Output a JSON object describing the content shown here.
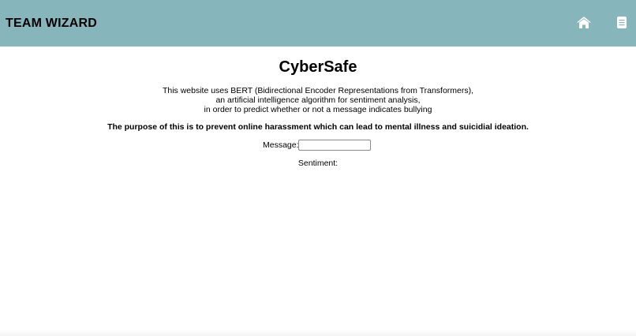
{
  "header": {
    "brand": "TEAM WIZARD",
    "icons": {
      "home": "home-icon",
      "document": "document-icon"
    },
    "background_color": "#86b5bb"
  },
  "main": {
    "title": "CyberSafe",
    "description_lines": [
      "This website uses BERT (Bidirectional Encoder Representations from Transformers),",
      "an artificial intelligence algorithm for sentiment analysis,",
      "in order to predict whether or not a message indicates bullying"
    ],
    "purpose": "The purpose of this is to prevent online harassment which can lead to mental illness and suicidial ideation.",
    "message_label": "Message:",
    "message_value": "",
    "sentiment_label": "Sentiment:"
  }
}
